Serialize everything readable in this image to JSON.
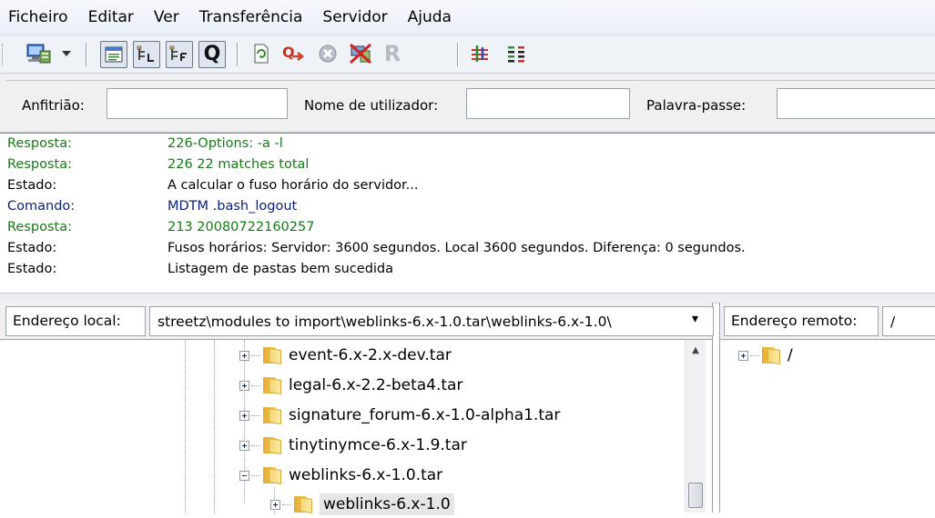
{
  "menu": {
    "items": [
      "Ficheiro",
      "Editar",
      "Ver",
      "Transferência",
      "Servidor",
      "Ajuda"
    ]
  },
  "toolbar": {
    "icons": [
      "site-manager-icon",
      "dropdown-arrow-icon",
      "toggle-log-icon",
      "toggle-local-tree-icon",
      "toggle-remote-tree-icon",
      "toggle-queue-icon",
      "refresh-icon",
      "process-queue-icon",
      "cancel-icon",
      "disconnect-icon",
      "reconnect-icon",
      "filter-icon",
      "compare-icon"
    ],
    "reconnect_glyph": "R",
    "queue_glyph": "Q"
  },
  "quickconnect": {
    "host_label": "Anfitrião:",
    "host_value": "",
    "user_label": "Nome de utilizador:",
    "user_value": "",
    "pass_label": "Palavra-passe:",
    "pass_value": ""
  },
  "log": [
    {
      "type": "Resposta:",
      "message": "226-Options: -a -l",
      "color": "#167a16"
    },
    {
      "type": "Resposta:",
      "message": "226 22 matches total",
      "color": "#167a16"
    },
    {
      "type": "Estado:",
      "message": "A calcular o fuso horário do servidor...",
      "color": "#000000"
    },
    {
      "type": "Comando:",
      "message": "MDTM .bash_logout",
      "color": "#0a1f7a"
    },
    {
      "type": "Resposta:",
      "message": "213 20080722160257",
      "color": "#167a16"
    },
    {
      "type": "Estado:",
      "message": "Fusos horários: Servidor: 3600 segundos. Local 3600 segundos. Diferença: 0 segundos.",
      "color": "#000000"
    },
    {
      "type": "Estado:",
      "message": "Listagem de pastas bem sucedida",
      "color": "#000000"
    }
  ],
  "local": {
    "label": "Endereço local:",
    "path": "streetz\\modules to import\\weblinks-6.x-1.0.tar\\weblinks-6.x-1.0\\",
    "dropdown_glyph": "▾",
    "tree": [
      {
        "name": "event-6.x-2.x-dev.tar",
        "expander": "plus"
      },
      {
        "name": "legal-6.x-2.2-beta4.tar",
        "expander": "plus"
      },
      {
        "name": "signature_forum-6.x-1.0-alpha1.tar",
        "expander": "plus"
      },
      {
        "name": "tinytinymce-6.x-1.9.tar",
        "expander": "plus"
      },
      {
        "name": "weblinks-6.x-1.0.tar",
        "expander": "minus"
      },
      {
        "name": "weblinks-6.x-1.0",
        "expander": "plus",
        "selected": true
      }
    ]
  },
  "remote": {
    "label": "Endereço remoto:",
    "path": "/",
    "tree": [
      {
        "name": "/",
        "expander": "plus"
      }
    ]
  },
  "colors": {
    "response": "#167a16",
    "command": "#0a1f7a",
    "selection": "#e6e6e6"
  }
}
